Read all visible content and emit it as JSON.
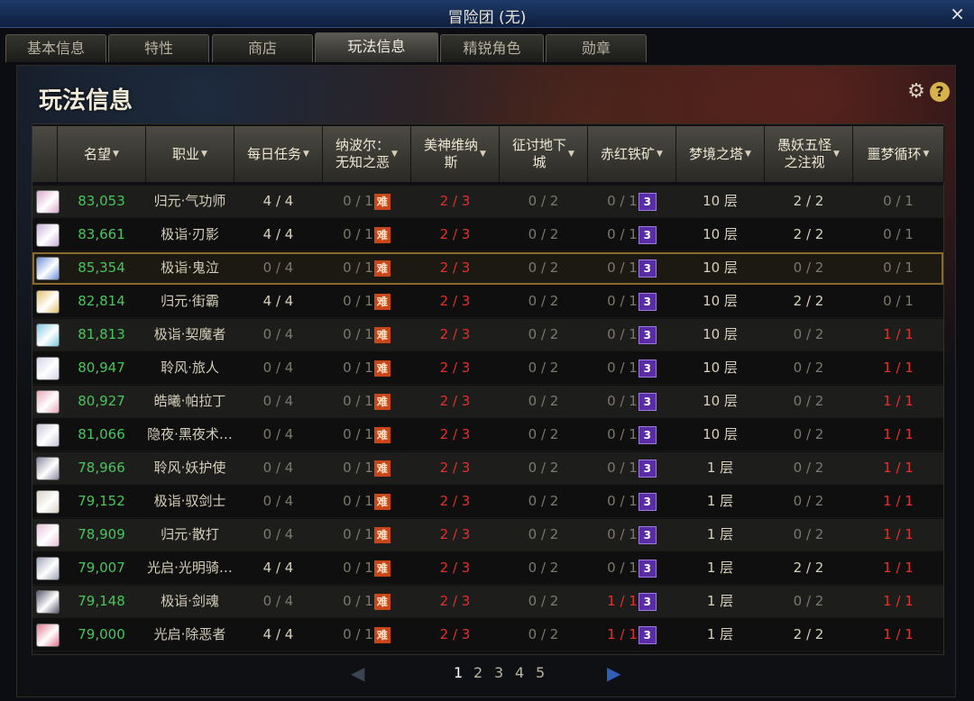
{
  "window": {
    "title": "冒险团 (无)",
    "close_label": "×"
  },
  "tabs": [
    "基本信息",
    "特性",
    "商店",
    "玩法信息",
    "精锐角色",
    "勋章"
  ],
  "active_tab": 3,
  "section_title": "玩法信息",
  "icons": {
    "settings": "gear-icon",
    "help": "help-icon",
    "gear_glyph": "⚙",
    "help_glyph": "?"
  },
  "columns": [
    {
      "label": "名望",
      "sortable": true
    },
    {
      "label": "职业",
      "sortable": true
    },
    {
      "label": "每日任务",
      "sortable": true
    },
    {
      "label": "纳波尔：\n无知之恶",
      "sortable": true
    },
    {
      "label": "美神维纳\n斯",
      "sortable": true
    },
    {
      "label": "征讨地下\n城",
      "sortable": true
    },
    {
      "label": "赤红铁矿",
      "sortable": true
    },
    {
      "label": "梦境之塔",
      "sortable": true
    },
    {
      "label": "愚妖五怪\n之注视",
      "sortable": true
    },
    {
      "label": "噩梦循环",
      "sortable": true
    }
  ],
  "badges": {
    "hard": "难",
    "three": "3"
  },
  "rows": [
    {
      "fame": "83,053",
      "job": "归元·气功师",
      "daily": "4 / 4",
      "nabol": "0 / 1",
      "venus": "2 / 3",
      "dungeon": "0 / 2",
      "ore": "0 / 1",
      "tower": "10 层",
      "five": "2 / 2",
      "nightmare": "0 / 1",
      "avatar": "#d9a8c8"
    },
    {
      "fame": "83,661",
      "job": "极诣·刃影",
      "daily": "4 / 4",
      "nabol": "0 / 1",
      "venus": "2 / 3",
      "dungeon": "0 / 2",
      "ore": "0 / 1",
      "tower": "10 层",
      "five": "2 / 2",
      "nightmare": "0 / 1",
      "avatar": "#c8b0d8"
    },
    {
      "fame": "85,354",
      "job": "极诣·鬼泣",
      "daily": "0 / 4",
      "nabol": "0 / 1",
      "venus": "2 / 3",
      "dungeon": "0 / 2",
      "ore": "0 / 1",
      "tower": "10 层",
      "five": "0 / 2",
      "nightmare": "0 / 1",
      "avatar": "#6a8fd8",
      "selected": true
    },
    {
      "fame": "82,814",
      "job": "归元·街霸",
      "daily": "4 / 4",
      "nabol": "0 / 1",
      "venus": "2 / 3",
      "dungeon": "0 / 2",
      "ore": "0 / 1",
      "tower": "10 层",
      "five": "2 / 2",
      "nightmare": "0 / 1",
      "avatar": "#e3c06a"
    },
    {
      "fame": "81,813",
      "job": "极诣·契魔者",
      "daily": "0 / 4",
      "nabol": "0 / 1",
      "venus": "2 / 3",
      "dungeon": "0 / 2",
      "ore": "0 / 1",
      "tower": "10 层",
      "five": "0 / 2",
      "nightmare": "1 / 1",
      "avatar": "#7fc8e0"
    },
    {
      "fame": "80,947",
      "job": "聆风·旅人",
      "daily": "0 / 4",
      "nabol": "0 / 1",
      "venus": "2 / 3",
      "dungeon": "0 / 2",
      "ore": "0 / 1",
      "tower": "10 层",
      "five": "0 / 2",
      "nightmare": "1 / 1",
      "avatar": "#d0d4e6"
    },
    {
      "fame": "80,927",
      "job": "皓曦·帕拉丁",
      "daily": "0 / 4",
      "nabol": "0 / 1",
      "venus": "2 / 3",
      "dungeon": "0 / 2",
      "ore": "0 / 1",
      "tower": "10 层",
      "five": "0 / 2",
      "nightmare": "1 / 1",
      "avatar": "#e8a8b8"
    },
    {
      "fame": "81,066",
      "job": "隐夜·黑夜术…",
      "daily": "0 / 4",
      "nabol": "0 / 1",
      "venus": "2 / 3",
      "dungeon": "0 / 2",
      "ore": "0 / 1",
      "tower": "10 层",
      "five": "0 / 2",
      "nightmare": "1 / 1",
      "avatar": "#c9c3d6"
    },
    {
      "fame": "78,966",
      "job": "聆风·妖护使",
      "daily": "0 / 4",
      "nabol": "0 / 1",
      "venus": "2 / 3",
      "dungeon": "0 / 2",
      "ore": "0 / 1",
      "tower": "1 层",
      "five": "0 / 2",
      "nightmare": "1 / 1",
      "avatar": "#8a8aa0"
    },
    {
      "fame": "79,152",
      "job": "极诣·驭剑士",
      "daily": "0 / 4",
      "nabol": "0 / 1",
      "venus": "2 / 3",
      "dungeon": "0 / 2",
      "ore": "0 / 1",
      "tower": "1 层",
      "five": "0 / 2",
      "nightmare": "1 / 1",
      "avatar": "#d8d0c4"
    },
    {
      "fame": "78,909",
      "job": "归元·散打",
      "daily": "0 / 4",
      "nabol": "0 / 1",
      "venus": "2 / 3",
      "dungeon": "0 / 2",
      "ore": "0 / 1",
      "tower": "1 层",
      "five": "0 / 2",
      "nightmare": "1 / 1",
      "avatar": "#e6c0d8"
    },
    {
      "fame": "79,007",
      "job": "光启·光明骑…",
      "daily": "4 / 4",
      "nabol": "0 / 1",
      "venus": "2 / 3",
      "dungeon": "0 / 2",
      "ore": "0 / 1",
      "tower": "1 层",
      "five": "2 / 2",
      "nightmare": "1 / 1",
      "avatar": "#9ea4b8"
    },
    {
      "fame": "79,148",
      "job": "极诣·剑魂",
      "daily": "0 / 4",
      "nabol": "0 / 1",
      "venus": "2 / 3",
      "dungeon": "0 / 2",
      "ore": "1 / 1",
      "tower": "1 层",
      "five": "0 / 2",
      "nightmare": "1 / 1",
      "avatar": "#5a5a70"
    },
    {
      "fame": "79,000",
      "job": "光启·除恶者",
      "daily": "4 / 4",
      "nabol": "0 / 1",
      "venus": "2 / 3",
      "dungeon": "0 / 2",
      "ore": "1 / 1",
      "tower": "1 层",
      "five": "2 / 2",
      "nightmare": "1 / 1",
      "avatar": "#e07890"
    }
  ],
  "pagination": {
    "pages": [
      "1",
      "2",
      "3",
      "4",
      "5"
    ],
    "current": "1",
    "prev": "◀",
    "next": "▶"
  },
  "colors": {
    "fame": "#47c65a",
    "red": "#e2312c",
    "badge_hard": "#c9461a",
    "badge_three": "#5b2ca8",
    "selected_border": "#8a6a2c"
  }
}
